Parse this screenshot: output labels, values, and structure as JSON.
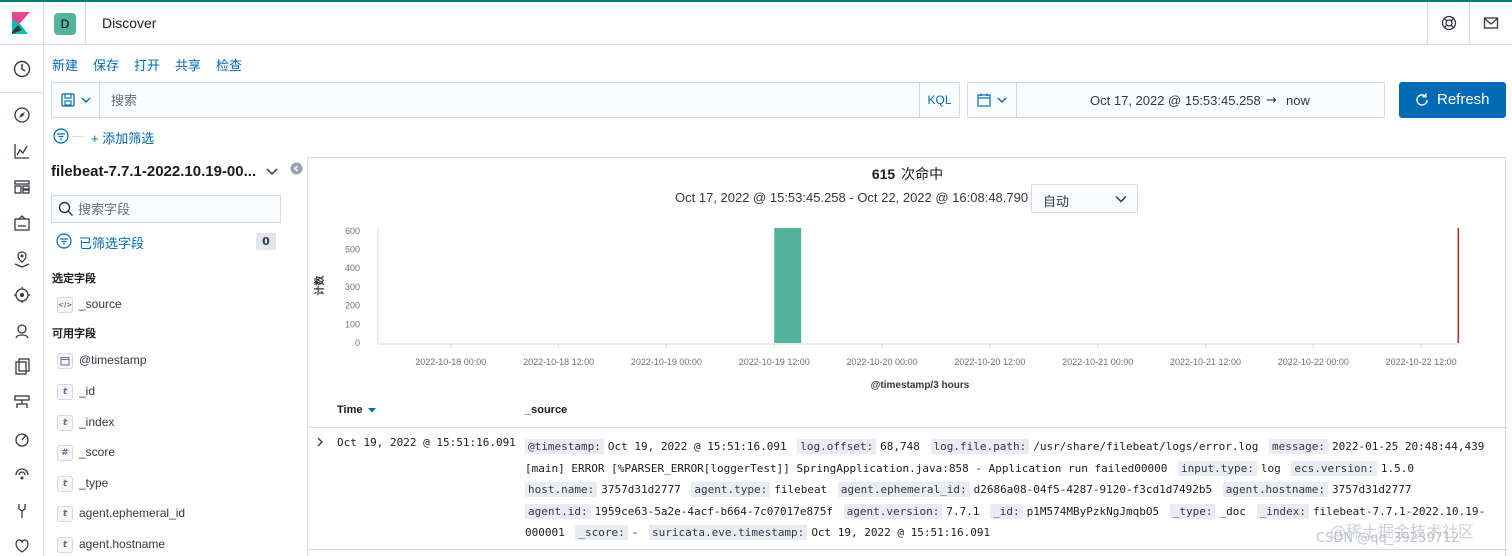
{
  "header": {
    "space_letter": "D",
    "app_title": "Discover"
  },
  "top_menu": [
    "新建",
    "保存",
    "打开",
    "共享",
    "检查"
  ],
  "query": {
    "placeholder": "搜索",
    "language": "KQL"
  },
  "time": {
    "start": "Oct 17, 2022 @ 15:53:45.258",
    "arrow": "→",
    "end": "now",
    "refresh_label": "Refresh"
  },
  "filters": {
    "add_label": "+ 添加筛选"
  },
  "sidebar": {
    "index_pattern": "filebeat-7.7.1-2022.10.19-00...",
    "search_placeholder": "搜索字段",
    "filtered_label": "已筛选字段",
    "filtered_count": "0",
    "selected_title": "选定字段",
    "selected_fields": [
      {
        "type": "</>",
        "name": "_source"
      }
    ],
    "available_title": "可用字段",
    "available_fields": [
      {
        "type": "date",
        "name": "@timestamp"
      },
      {
        "type": "t",
        "name": "_id"
      },
      {
        "type": "t",
        "name": "_index"
      },
      {
        "type": "#",
        "name": "_score"
      },
      {
        "type": "t",
        "name": "_type"
      },
      {
        "type": "t",
        "name": "agent.ephemeral_id"
      },
      {
        "type": "t",
        "name": "agent.hostname"
      }
    ]
  },
  "main": {
    "hits_count": "615",
    "hits_label": "次命中",
    "range_text": "Oct 17, 2022 @ 15:53:45.258 - Oct 22, 2022 @ 16:08:48.790 —",
    "interval": "自动"
  },
  "chart_data": {
    "type": "bar",
    "ylabel": "计数",
    "xlabel": "@timestamp/3 hours",
    "y_ticks": [
      "0",
      "100",
      "200",
      "300",
      "400",
      "500",
      "600"
    ],
    "ylim": [
      0,
      615
    ],
    "x_ticks": [
      "2022-10-18 00:00",
      "2022-10-18 12:00",
      "2022-10-19 00:00",
      "2022-10-19 12:00",
      "2022-10-20 00:00",
      "2022-10-20 12:00",
      "2022-10-21 00:00",
      "2022-10-21 12:00",
      "2022-10-22 00:00",
      "2022-10-22 12:00"
    ],
    "x_start_hours_before_first_tick": 8.1,
    "x_end_hours_after_first_tick": 112.1,
    "bars": [
      {
        "bucket_start": "2022-10-19 12:00",
        "bucket_hours": 3,
        "value": 615
      }
    ],
    "now_marker": "2022-10-22 16:08",
    "colors": {
      "bar": "#54b399",
      "now_marker": "#bd271e"
    },
    "grid": false
  },
  "table": {
    "columns": [
      "Time",
      "_source"
    ],
    "rows": [
      {
        "time": "Oct 19, 2022 @ 15:51:16.091",
        "source": [
          {
            "k": "@timestamp:",
            "v": "Oct 19, 2022 @ 15:51:16.091"
          },
          {
            "k": "log.offset:",
            "v": "68,748"
          },
          {
            "k": "log.file.path:",
            "v": "/usr/share/filebeat/logs/error.log"
          },
          {
            "k": "message:",
            "v": "2022-01-25 20:48:44,439 [main] ERROR [%PARSER_ERROR[loggerTest]] SpringApplication.java:858 - Application run failed00000"
          },
          {
            "k": "input.type:",
            "v": "log"
          },
          {
            "k": "ecs.version:",
            "v": "1.5.0"
          },
          {
            "k": "host.name:",
            "v": "3757d31d2777"
          },
          {
            "k": "agent.type:",
            "v": "filebeat"
          },
          {
            "k": "agent.ephemeral_id:",
            "v": "d2686a08-04f5-4287-9120-f3cd1d7492b5"
          },
          {
            "k": "agent.hostname:",
            "v": "3757d31d2777"
          },
          {
            "k": "agent.id:",
            "v": "1959ce63-5a2e-4acf-b664-7c07017e875f"
          },
          {
            "k": "agent.version:",
            "v": "7.7.1"
          },
          {
            "k": "_id:",
            "v": "p1M574MByPzkNgJmqbO5"
          },
          {
            "k": "_type:",
            "v": "_doc"
          },
          {
            "k": "_index:",
            "v": "filebeat-7.7.1-2022.10.19-000001"
          },
          {
            "k": "_score:",
            "v": "-"
          },
          {
            "k": "suricata.eve.timestamp:",
            "v": "Oct 19, 2022 @ 15:51:16.091"
          }
        ]
      }
    ]
  },
  "watermark": {
    "line1": "@稀土掘金技术社区",
    "line2": "CSDN @qq_39239712"
  }
}
